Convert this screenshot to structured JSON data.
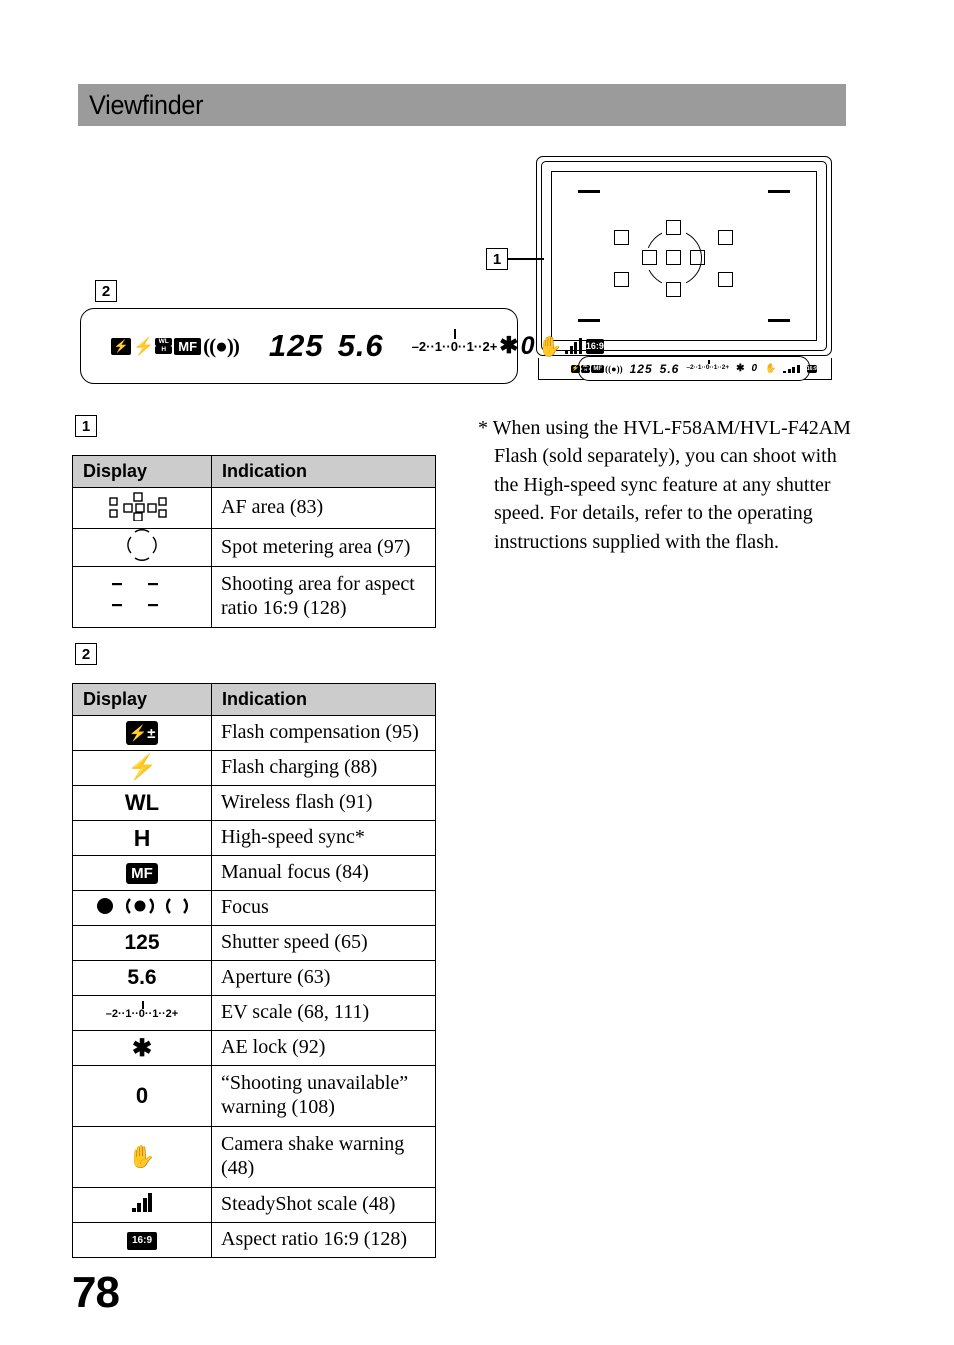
{
  "header": {
    "title": "Viewfinder"
  },
  "page": {
    "number": "78"
  },
  "callouts": {
    "one": "1",
    "two": "2"
  },
  "lcd": {
    "flash_compensation": "⚡",
    "plus_minus": "+–",
    "flash_bolt": "⚡",
    "wl": "WL",
    "h": "H",
    "mf": "MF",
    "shutter_speed": "125",
    "aperture": "5.6",
    "ev_scale": "–2··1··0··1··2+",
    "ae_lock": "✱",
    "shooting_unavailable": "0",
    "aspect_ratio": "16:9"
  },
  "table_1": {
    "marker": "1",
    "headers": {
      "display": "Display",
      "indication": "Indication"
    },
    "rows": [
      {
        "icon": "af-area-icon",
        "indication": "AF area (83)"
      },
      {
        "icon": "spot-metering-icon",
        "indication": "Spot metering area (97)"
      },
      {
        "icon": "aspect-marks-icon",
        "indication": "Shooting area for aspect ratio 16:9 (128)"
      }
    ]
  },
  "table_2": {
    "marker": "2",
    "headers": {
      "display": "Display",
      "indication": "Indication"
    },
    "rows": [
      {
        "icon": "flash-compensation-icon",
        "indication": "Flash compensation (95)"
      },
      {
        "icon": "flash-charging-icon",
        "indication": "Flash charging (88)"
      },
      {
        "icon": "wireless-flash-icon",
        "label": "WL",
        "indication": "Wireless flash (91)"
      },
      {
        "icon": "high-speed-sync-icon",
        "label": "H",
        "indication": "High-speed sync*"
      },
      {
        "icon": "manual-focus-icon",
        "label": "MF",
        "indication": "Manual focus (84)"
      },
      {
        "icon": "focus-indicator-icon",
        "indication": "Focus"
      },
      {
        "icon": "shutter-speed-value",
        "label": "125",
        "indication": "Shutter speed (65)"
      },
      {
        "icon": "aperture-value",
        "label": "5.6",
        "indication": "Aperture (63)"
      },
      {
        "icon": "ev-scale-icon",
        "indication": "EV scale (68, 111)"
      },
      {
        "icon": "ae-lock-icon",
        "label": "✱",
        "indication": "AE lock (92)"
      },
      {
        "icon": "shooting-unavailable-icon",
        "label": "0",
        "indication": "“Shooting unavailable” warning (108)"
      },
      {
        "icon": "camera-shake-icon",
        "indication": "Camera shake warning (48)"
      },
      {
        "icon": "steadyshot-scale-icon",
        "indication": "SteadyShot scale (48)"
      },
      {
        "icon": "aspect-ratio-icon",
        "label": "16:9",
        "indication": "Aspect ratio 16:9 (128)"
      }
    ]
  },
  "footnote": {
    "text": "* When using the HVL-F58AM/HVL-F42AM Flash (sold separately), you can shoot with the High-speed sync feature at any shutter speed. For details, refer to the operating instructions supplied with the flash."
  }
}
